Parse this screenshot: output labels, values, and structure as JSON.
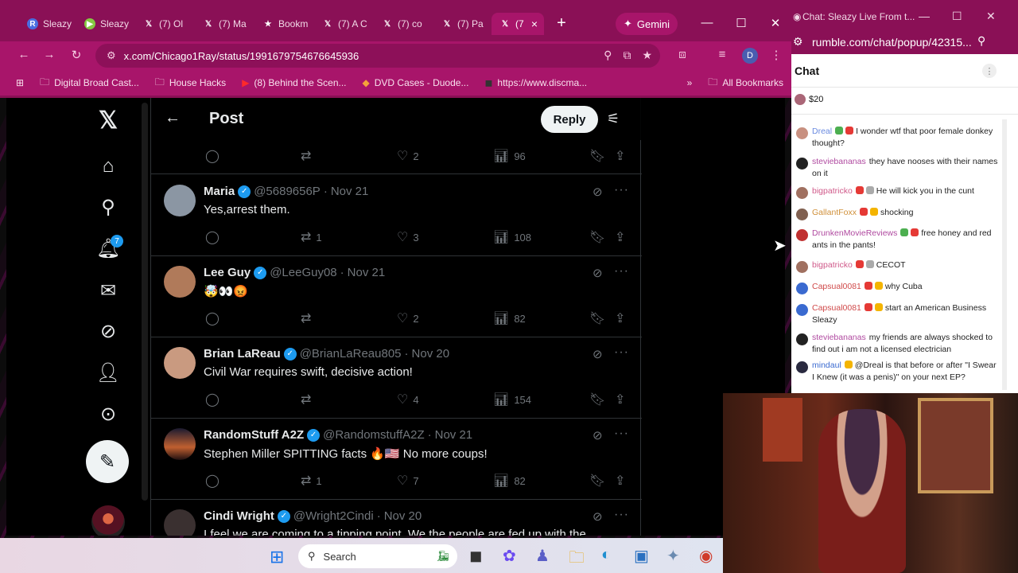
{
  "browser": {
    "tabs": [
      {
        "label": "Sleazy",
        "fav": "R",
        "fav_color": "#4a6ee0"
      },
      {
        "label": "Sleazy",
        "fav": "▶",
        "fav_color": "#85c742"
      },
      {
        "label": "(7) Ol",
        "fav": "𝕏",
        "fav_color": "#000000"
      },
      {
        "label": "(7) Ma",
        "fav": "𝕏",
        "fav_color": "#000000"
      },
      {
        "label": "Bookm",
        "fav": "★",
        "fav_color": "#8a1056"
      },
      {
        "label": "(7) A C",
        "fav": "𝕏",
        "fav_color": "#000000"
      },
      {
        "label": "(7) co",
        "fav": "𝕏",
        "fav_color": "#000000"
      },
      {
        "label": "(7) Pa",
        "fav": "𝕏",
        "fav_color": "#000000"
      },
      {
        "label": "(7",
        "fav": "𝕏",
        "fav_color": "#000000",
        "close": "×"
      }
    ],
    "new_tab": "+",
    "gemini_label": "Gemini",
    "url": "x.com/Chicago1Ray/status/1991679754676645936",
    "profile_initial": "D",
    "bookmarks": [
      {
        "label": "Digital Broad Cast...",
        "icon": "folder-icon"
      },
      {
        "label": "House Hacks",
        "icon": "folder-icon"
      },
      {
        "label": "(8) Behind the Scen...",
        "icon": "youtube-icon"
      },
      {
        "label": "DVD Cases - Duode...",
        "icon": "site-icon"
      },
      {
        "label": "https://www.discma...",
        "icon": "site-icon"
      }
    ],
    "all_bookmarks": "All Bookmarks",
    "more_bookmarks": "»"
  },
  "x": {
    "header_title": "Post",
    "reply_button": "Reply",
    "notifications_count": "7",
    "first_actions": {
      "replies": "",
      "reposts": "",
      "likes": "2",
      "views": "96"
    },
    "replies": [
      {
        "name": "Maria",
        "handle": "@5689656P",
        "date": "Nov 21",
        "text": "Yes,arrest them.",
        "replies": "",
        "reposts": "1",
        "likes": "3",
        "views": "108",
        "avatar_color": "#8b96a3"
      },
      {
        "name": "Lee Guy",
        "handle": "@LeeGuy08",
        "date": "Nov 21",
        "text": "🤯👀😡",
        "replies": "",
        "reposts": "",
        "likes": "2",
        "views": "82",
        "avatar_color": "#b07a5a"
      },
      {
        "name": "Brian LaReau",
        "handle": "@BrianLaReau805",
        "date": "Nov 20",
        "text": "Civil War requires swift, decisive action!",
        "replies": "",
        "reposts": "",
        "likes": "4",
        "views": "154",
        "avatar_color": "#c99a80"
      },
      {
        "name": "RandomStuff A2Z",
        "handle": "@RandomstuffA2Z",
        "date": "Nov 21",
        "text": "Stephen Miller SPITTING facts 🔥🇺🇸 No more coups!",
        "replies": "",
        "reposts": "1",
        "likes": "7",
        "views": "82",
        "avatar_color": "#5a3a3a"
      },
      {
        "name": "Cindi Wright",
        "handle": "@Wright2Cindi",
        "date": "Nov 20",
        "text": "I feel we are coming to a tipping point. We the people are fed up with the",
        "replies": "",
        "reposts": "",
        "likes": "",
        "views": "",
        "avatar_color": "#3a3030"
      }
    ]
  },
  "chat": {
    "window_title": "Chat: Sleazy Live From t...",
    "url": "rumble.com/chat/popup/42315...",
    "title": "Chat",
    "rant_amount": "$20",
    "messages": [
      {
        "user": "Dreal",
        "color": "#6a8ae0",
        "text": "I wonder wtf that poor female donkey thought?",
        "av": "#c89080"
      },
      {
        "user": "steviebananas",
        "color": "#b04aa0",
        "text": "they have nooses with their names on it",
        "av": "#222222"
      },
      {
        "user": "bigpatricko",
        "color": "#d05a8a",
        "text": "He will kick you in the cunt",
        "av": "#a07060"
      },
      {
        "user": "GallantFoxx",
        "color": "#d0903a",
        "text": "shocking",
        "av": "#806050"
      },
      {
        "user": "DrunkenMovieReviews",
        "color": "#b04aa0",
        "text": "free honey and red ants in the pants!",
        "av": "#c03030"
      },
      {
        "user": "bigpatricko",
        "color": "#d05a8a",
        "text": "CECOT",
        "av": "#a07060"
      },
      {
        "user": "Capsual0081",
        "color": "#d04a4a",
        "text": "why Cuba",
        "av": "#3a6ad0"
      },
      {
        "user": "Capsual0081",
        "color": "#d04a4a",
        "text": "start an American Business Sleazy",
        "av": "#3a6ad0"
      },
      {
        "user": "steviebananas",
        "color": "#b04aa0",
        "text": "my friends are always shocked to find out i am not a licensed electrician",
        "av": "#222222"
      },
      {
        "user": "mindaul",
        "color": "#3a6ad0",
        "text": "@Dreal is that before or after \"I Swear I Knew (it was a penis)\" on your next EP?",
        "av": "#2a2a40"
      }
    ]
  },
  "taskbar": {
    "search_placeholder": "Search"
  }
}
